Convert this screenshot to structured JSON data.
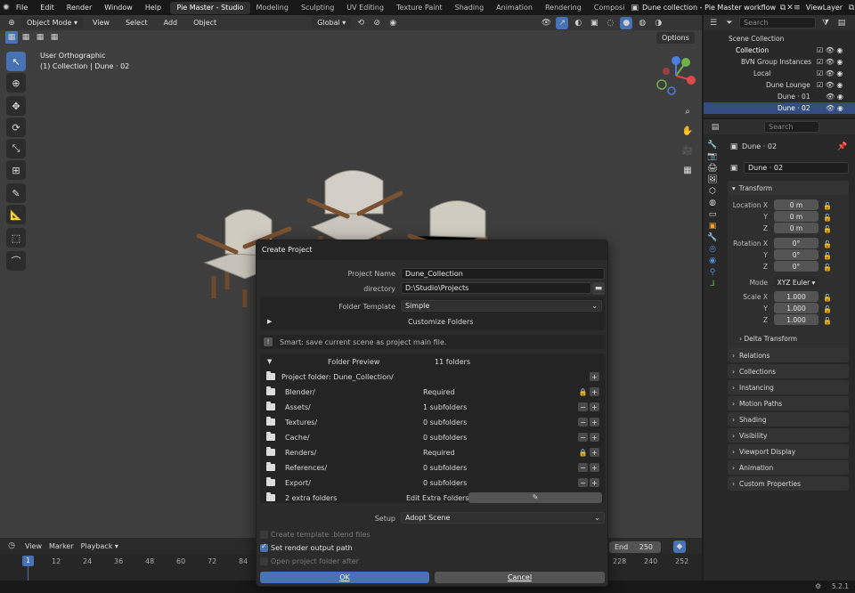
{
  "topbar": {
    "menus": [
      "File",
      "Edit",
      "Render",
      "Window",
      "Help"
    ],
    "workspaces": [
      "Pie Master - Studio",
      "Modeling",
      "Sculpting",
      "UV Editing",
      "Texture Paint",
      "Shading",
      "Animation",
      "Rendering",
      "Composi"
    ],
    "scene_name": "Dune collection - Pie Master workflow",
    "view_layer": "ViewLayer"
  },
  "viewport": {
    "mode": "Object Mode",
    "menus": [
      "View",
      "Select",
      "Add",
      "Object"
    ],
    "orientation": "Global",
    "options_label": "Options",
    "view_name": "User Orthographic",
    "view_sub": "(1) Collection | Dune · 02"
  },
  "dialog": {
    "title": "Create Project",
    "project_name_label": "Project Name",
    "project_name": "Dune_Collection",
    "directory_label": "directory",
    "directory": "D:\\Studio\\Projects",
    "folder_template_label": "Folder Template",
    "folder_template": "Simple",
    "customize_label": "Customize Folders",
    "smart_note": "Smart: save current scene as project main file.",
    "preview_label": "Folder Preview",
    "preview_count": "11 folders",
    "project_folder": "Project folder: Dune_Collection/",
    "folders": [
      {
        "name": "Blender/",
        "status": "Required",
        "locked": true
      },
      {
        "name": "Assets/",
        "status": "1 subfolders",
        "locked": false
      },
      {
        "name": "Textures/",
        "status": "0 subfolders",
        "locked": false
      },
      {
        "name": "Cache/",
        "status": "0 subfolders",
        "locked": false
      },
      {
        "name": "Renders/",
        "status": "Required",
        "locked": true
      },
      {
        "name": "References/",
        "status": "0 subfolders",
        "locked": false
      },
      {
        "name": "Export/",
        "status": "0 subfolders",
        "locked": false
      }
    ],
    "extra_folders": "2 extra folders",
    "edit_extra": "Edit Extra Folders",
    "setup_label": "Setup",
    "setup_value": "Adopt Scene",
    "options": [
      {
        "label": "Create template .blend files",
        "checked": false,
        "enabled": false
      },
      {
        "label": "Set render output path",
        "checked": true,
        "enabled": true
      },
      {
        "label": "Open project folder after",
        "checked": false,
        "enabled": false
      }
    ],
    "ok_label": "OK",
    "cancel_label": "Cancel"
  },
  "outliner": {
    "search_placeholder": "Search",
    "rows": [
      {
        "label": "Scene Collection"
      },
      {
        "label": "Collection"
      },
      {
        "label": "BVN Group Instances"
      },
      {
        "label": "Local"
      },
      {
        "label": "Dune Lounge"
      },
      {
        "label": "Dune · 01"
      },
      {
        "label": "Dune · 02"
      }
    ]
  },
  "properties": {
    "search_placeholder": "Search",
    "object_name": "Dune · 02",
    "object_field": "Dune · 02",
    "transform_label": "Transform",
    "location_label": "Location X",
    "location": [
      "0 m",
      "0 m",
      "0 m"
    ],
    "rotation_label": "Rotation X",
    "rotation": [
      "0°",
      "0°",
      "0°"
    ],
    "mode_label": "Mode",
    "mode_value": "XYZ Euler",
    "scale_label": "Scale X",
    "scale": [
      "1.000",
      "1.000",
      "1.000"
    ],
    "axis_y": "Y",
    "axis_z": "Z",
    "delta_label": "Delta Transform",
    "sections": [
      "Relations",
      "Collections",
      "Instancing",
      "Motion Paths",
      "Shading",
      "Visibility",
      "Viewport Display",
      "Animation",
      "Custom Properties"
    ]
  },
  "timeline": {
    "menus": [
      "View",
      "Marker",
      "Playback"
    ],
    "end_label": "End",
    "end_value": "250",
    "current_frame": "1",
    "ticks": [
      "12",
      "24",
      "36",
      "48",
      "60",
      "72",
      "84",
      "228",
      "240",
      "252"
    ]
  },
  "status": {
    "version": "5.2.1"
  },
  "colors": {
    "accent": "#4772b3",
    "selected_row": "#334d80"
  }
}
